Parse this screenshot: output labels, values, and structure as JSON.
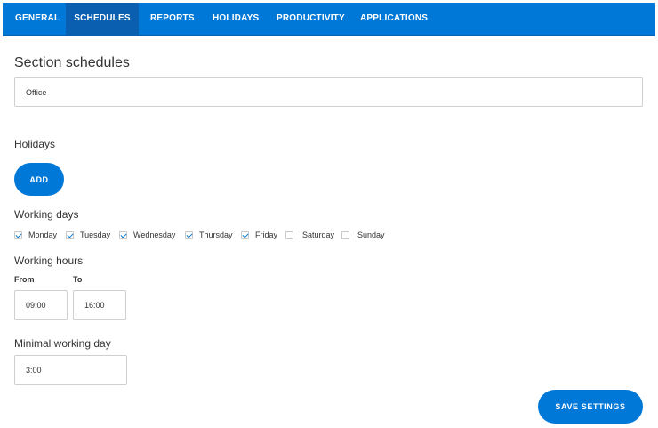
{
  "nav": {
    "tabs": [
      {
        "label": "GENERAL",
        "active": false
      },
      {
        "label": "SCHEDULES",
        "active": true
      },
      {
        "label": "REPORTS",
        "active": false
      },
      {
        "label": "HOLIDAYS",
        "active": false
      },
      {
        "label": "PRODUCTIVITY",
        "active": false
      },
      {
        "label": "APPLICATIONS",
        "active": false
      }
    ]
  },
  "section": {
    "title": "Section schedules",
    "name_value": "Office"
  },
  "holidays": {
    "label": "Holidays",
    "add_label": "ADD"
  },
  "working_days": {
    "label": "Working days",
    "days": [
      {
        "label": "Monday",
        "checked": true
      },
      {
        "label": "Tuesday",
        "checked": true
      },
      {
        "label": "Wednesday",
        "checked": true
      },
      {
        "label": "Thursday",
        "checked": true
      },
      {
        "label": "Friday",
        "checked": true
      },
      {
        "label": "Saturday",
        "checked": false
      },
      {
        "label": "Sunday",
        "checked": false
      }
    ]
  },
  "working_hours": {
    "label": "Working hours",
    "from_label": "From",
    "from_value": "09:00",
    "to_label": "To",
    "to_value": "16:00"
  },
  "minimal_day": {
    "label": "Minimal working day",
    "value": "3:00"
  },
  "save_label": "SAVE SETTINGS",
  "colors": {
    "accent": "#0078d7",
    "active_tab": "#0a5fb0"
  }
}
